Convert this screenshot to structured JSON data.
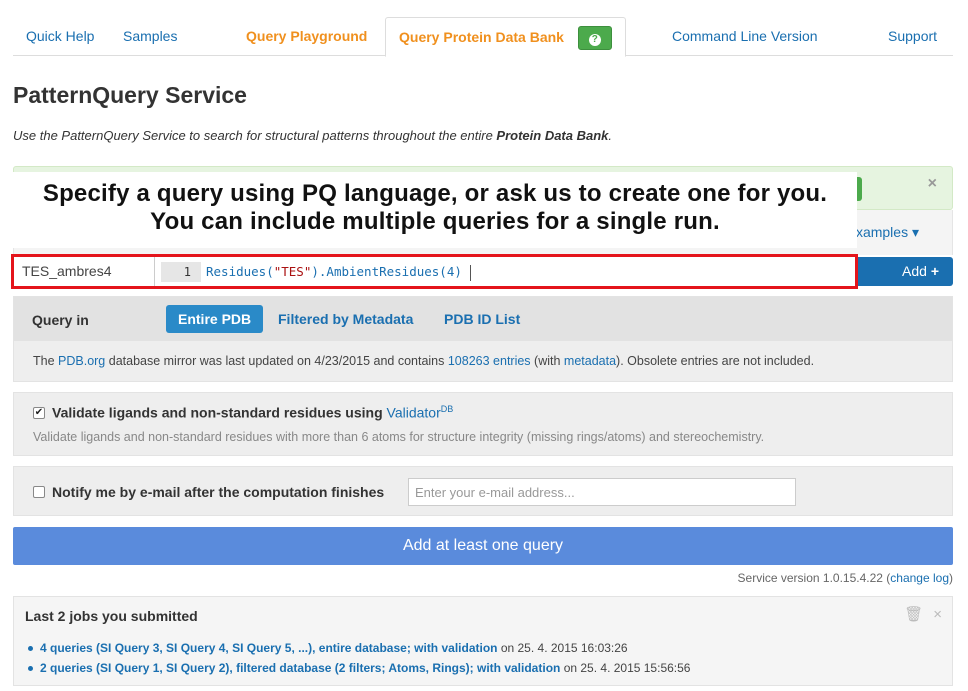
{
  "nav": {
    "tabs": [
      {
        "label": "Quick Help"
      },
      {
        "label": "Samples"
      },
      {
        "label": "Query Playground"
      },
      {
        "label": "Query Protein Data Bank"
      },
      {
        "label": "Command Line Version"
      },
      {
        "label": "Support"
      }
    ],
    "help_badge": "?"
  },
  "page": {
    "title": "PatternQuery Service",
    "intro_prefix": "Use the PatternQuery Service to search for structural patterns throughout the entire ",
    "intro_bold": "Protein Data Bank",
    "intro_suffix": "."
  },
  "banner": {
    "line1": "Specify a query using PQ language, or ask us to create one for you.",
    "line2": "You can include multiple queries for a single run."
  },
  "examples": {
    "label": "xamples"
  },
  "alert": {
    "close": "×"
  },
  "query": {
    "name": "TES_ambres4",
    "line_number": "1",
    "code_fn1": "Residues(",
    "code_str": "\"TES\"",
    "code_fn2": ").AmbientResidues(4)",
    "add_label": "Add",
    "add_icon": "+"
  },
  "query_in": {
    "label": "Query in",
    "options": [
      "Entire PDB",
      "Filtered by Metadata",
      "PDB ID List"
    ],
    "selected": "Entire PDB",
    "info": {
      "t1": "The ",
      "link1": "PDB.org",
      "t2": " database mirror was last updated on 4/23/2015 and contains ",
      "link2": "108263 entries",
      "t3": " (with ",
      "link3": "metadata",
      "t4": "). Obsolete entries are not included."
    }
  },
  "validate": {
    "checked": true,
    "check_glyph": "✔",
    "label": "Validate ligands and non-standard residues using ",
    "link": "Validator",
    "sup": "DB",
    "description": "Validate ligands and non-standard residues with more than 6 atoms for structure integrity (missing rings/atoms) and stereochemistry."
  },
  "notify": {
    "checked": false,
    "label": "Notify me by e-mail after the computation finishes",
    "placeholder": "Enter your e-mail address..."
  },
  "submit": {
    "label": "Add at least one query"
  },
  "version": {
    "text": "Service version 1.0.15.4.22 (",
    "link": "change log",
    "close": ")"
  },
  "jobs": {
    "title": "Last 2 jobs you submitted",
    "items": [
      {
        "link": "4 queries (SI Query 3, SI Query 4, SI Query 5, ...), entire database; with validation",
        "date": " on 25. 4. 2015 16:03:26"
      },
      {
        "link": "2 queries (SI Query 1, SI Query 2), filtered database (2 filters; Atoms, Rings); with validation",
        "date": " on 25. 4. 2015 15:56:56"
      }
    ],
    "trash_icon": "🗑",
    "close_icon": "×"
  }
}
